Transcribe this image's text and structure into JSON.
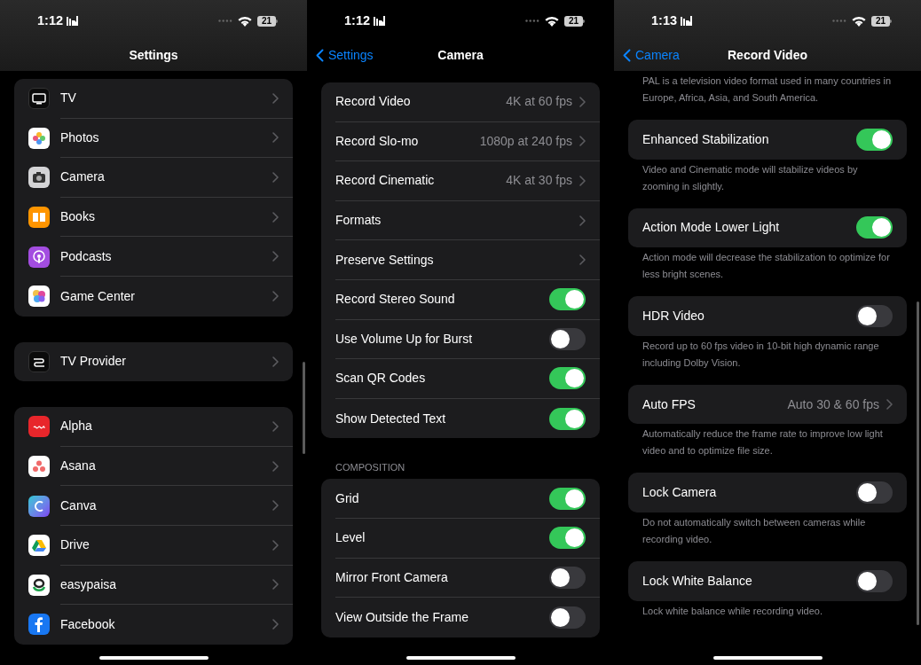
{
  "screens": [
    {
      "status_bar": {
        "time": "1:12",
        "battery": "21"
      },
      "nav": {
        "title": "Settings"
      },
      "groups": [
        {
          "rows": [
            {
              "label": "TV",
              "kind": "link"
            },
            {
              "label": "Photos",
              "kind": "link"
            },
            {
              "label": "Camera",
              "kind": "link"
            },
            {
              "label": "Books",
              "kind": "link"
            },
            {
              "label": "Podcasts",
              "kind": "link"
            },
            {
              "label": "Game Center",
              "kind": "link"
            }
          ]
        },
        {
          "rows": [
            {
              "label": "TV Provider",
              "kind": "link"
            }
          ]
        },
        {
          "rows": [
            {
              "label": "Alpha",
              "kind": "link"
            },
            {
              "label": "Asana",
              "kind": "link"
            },
            {
              "label": "Canva",
              "kind": "link"
            },
            {
              "label": "Drive",
              "kind": "link"
            },
            {
              "label": "easypaisa",
              "kind": "link"
            },
            {
              "label": "Facebook",
              "kind": "link"
            }
          ]
        }
      ]
    },
    {
      "status_bar": {
        "time": "1:12",
        "battery": "21"
      },
      "nav": {
        "back": "Settings",
        "title": "Camera"
      },
      "groups": [
        {
          "rows": [
            {
              "label": "Record Video",
              "kind": "link",
              "value": "4K at 60 fps"
            },
            {
              "label": "Record Slo-mo",
              "kind": "link",
              "value": "1080p at 240 fps"
            },
            {
              "label": "Record Cinematic",
              "kind": "link",
              "value": "4K at 30 fps"
            },
            {
              "label": "Formats",
              "kind": "link"
            },
            {
              "label": "Preserve Settings",
              "kind": "link"
            },
            {
              "label": "Record Stereo Sound",
              "kind": "toggle",
              "on": true
            },
            {
              "label": "Use Volume Up for Burst",
              "kind": "toggle",
              "on": false
            },
            {
              "label": "Scan QR Codes",
              "kind": "toggle",
              "on": true
            },
            {
              "label": "Show Detected Text",
              "kind": "toggle",
              "on": true
            }
          ]
        },
        {
          "header": "COMPOSITION",
          "rows": [
            {
              "label": "Grid",
              "kind": "toggle",
              "on": true
            },
            {
              "label": "Level",
              "kind": "toggle",
              "on": true
            },
            {
              "label": "Mirror Front Camera",
              "kind": "toggle",
              "on": false
            },
            {
              "label": "View Outside the Frame",
              "kind": "toggle",
              "on": false
            }
          ]
        }
      ]
    },
    {
      "status_bar": {
        "time": "1:13",
        "battery": "21"
      },
      "nav": {
        "back": "Camera",
        "title": "Record Video"
      },
      "groups": [
        {
          "footer": "PAL is a television video format used in many countries in Europe, Africa, Asia, and South America."
        },
        {
          "rows": [
            {
              "label": "Enhanced Stabilization",
              "kind": "toggle",
              "on": true
            }
          ],
          "footer": "Video and Cinematic mode will stabilize videos by zooming in slightly."
        },
        {
          "rows": [
            {
              "label": "Action Mode Lower Light",
              "kind": "toggle",
              "on": true
            }
          ],
          "footer": "Action mode will decrease the stabilization to optimize for less bright scenes."
        },
        {
          "rows": [
            {
              "label": "HDR Video",
              "kind": "toggle",
              "on": false
            }
          ],
          "footer": "Record up to 60 fps video in 10-bit high dynamic range including Dolby Vision."
        },
        {
          "rows": [
            {
              "label": "Auto FPS",
              "kind": "link",
              "value": "Auto 30 & 60 fps"
            }
          ],
          "footer": "Automatically reduce the frame rate to improve low light video and to optimize file size."
        },
        {
          "rows": [
            {
              "label": "Lock Camera",
              "kind": "toggle",
              "on": false
            }
          ],
          "footer": "Do not automatically switch between cameras while recording video."
        },
        {
          "rows": [
            {
              "label": "Lock White Balance",
              "kind": "toggle",
              "on": false
            }
          ],
          "footer": "Lock white balance while recording video."
        }
      ]
    }
  ]
}
